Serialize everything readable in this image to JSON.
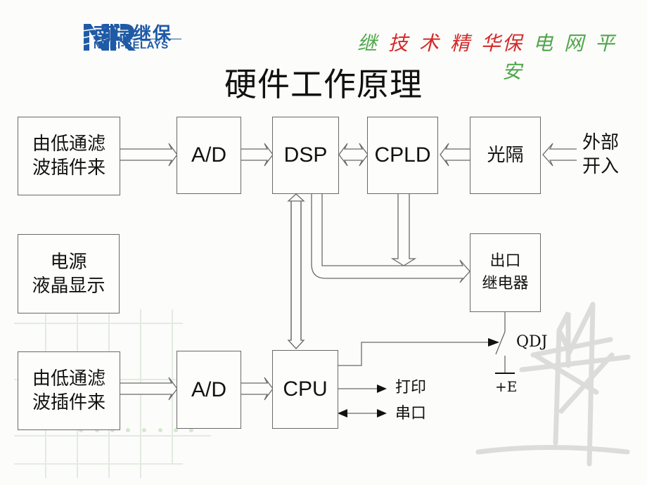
{
  "header": {
    "logo_cn": "南瑞继保",
    "logo_en": "NARI-RELAYS",
    "slogan_part1": [
      "继",
      "技",
      "术",
      "精",
      "华"
    ],
    "slogan_part2": [
      "保",
      "电",
      "网",
      "平",
      "安"
    ],
    "colors": {
      "brand_blue": "#1f5aa6",
      "slogan_green": "#4fa64a",
      "slogan_red": "#d42a2a"
    }
  },
  "page_title": "硬件工作原理",
  "blocks": {
    "lpf_top": [
      "由低通滤",
      "波插件来"
    ],
    "ad_top": "A/D",
    "dsp": "DSP",
    "cpld": "CPLD",
    "optocoupler": "光隔",
    "external_input": [
      "外部",
      "开入"
    ],
    "power_lcd": [
      "电源",
      "液晶显示"
    ],
    "output_relay": [
      "出口",
      "继电器"
    ],
    "lpf_bottom": [
      "由低通滤",
      "波插件来"
    ],
    "ad_bottom": "A/D",
    "cpu": "CPU"
  },
  "labels": {
    "print": "打印",
    "serial": "串口",
    "qdj": "QDJ",
    "plus_e": "+E"
  }
}
